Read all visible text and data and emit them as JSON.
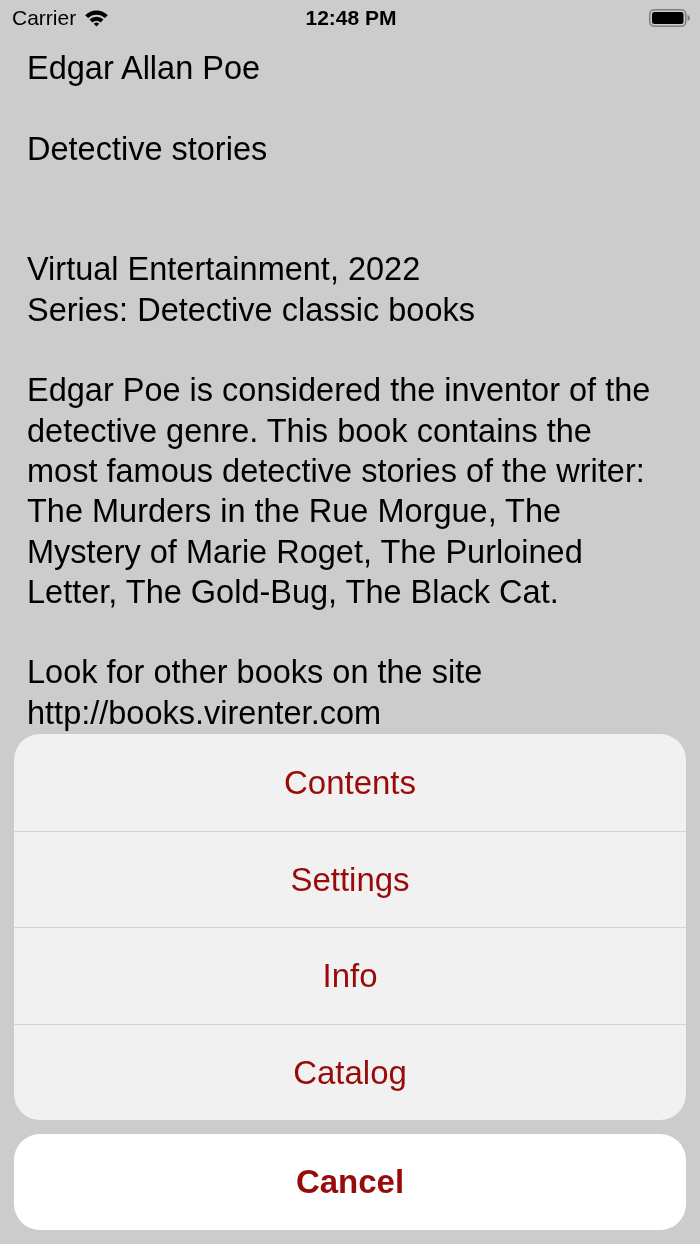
{
  "status_bar": {
    "carrier": "Carrier",
    "time": "12:48 PM"
  },
  "book": {
    "author": "Edgar Allan Poe",
    "title": "Detective stories",
    "publisher": "Virtual Entertainment, 2022",
    "series": "Series: Detective classic books",
    "description": "Edgar Poe is considered the inventor of the detective genre. This book contains the most famous detective stories of the writer: The Murders in the Rue Morgue, The Mystery of Marie Roget, The Purloined Letter, The Gold-Bug, The Black Cat.",
    "note": "Look for other books on the site http://books.virenter.com"
  },
  "action_sheet": {
    "actions": [
      "Contents",
      "Settings",
      "Info",
      "Catalog"
    ],
    "cancel": "Cancel"
  }
}
